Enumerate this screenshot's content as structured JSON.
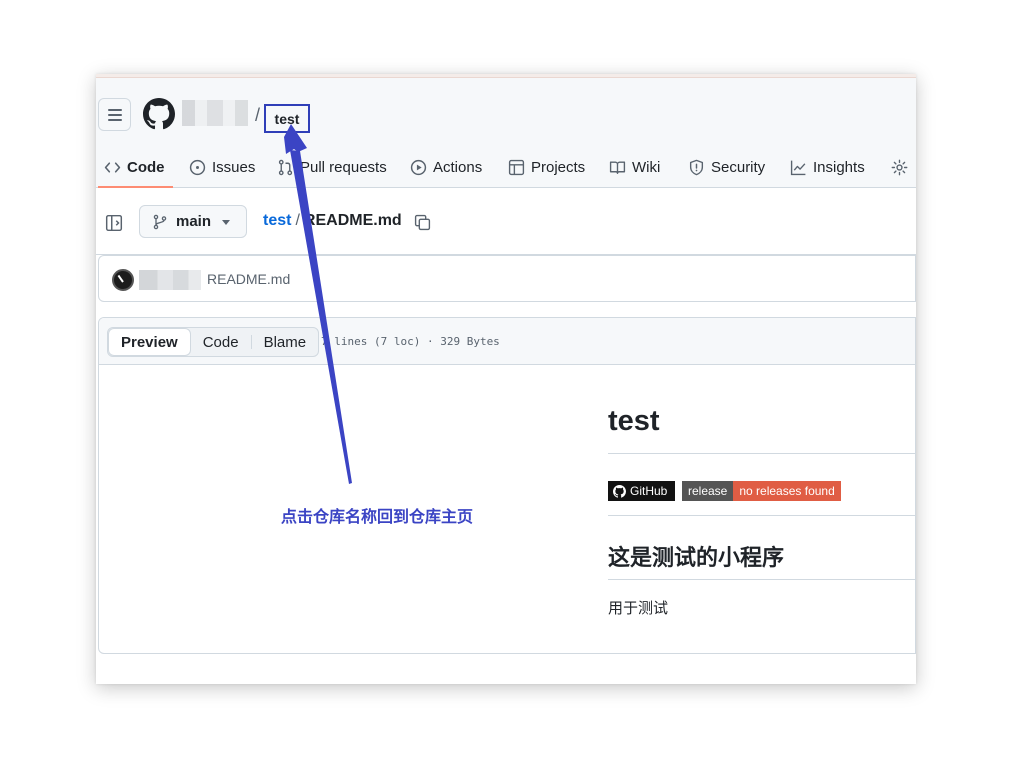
{
  "header": {
    "repo_name": "test",
    "slash": "/"
  },
  "tabs": [
    {
      "label": "Code",
      "icon": "code-icon",
      "active": true
    },
    {
      "label": "Issues",
      "icon": "issue-icon"
    },
    {
      "label": "Pull requests",
      "icon": "pull-request-icon"
    },
    {
      "label": "Actions",
      "icon": "play-icon"
    },
    {
      "label": "Projects",
      "icon": "table-icon"
    },
    {
      "label": "Wiki",
      "icon": "book-icon"
    },
    {
      "label": "Security",
      "icon": "shield-icon"
    },
    {
      "label": "Insights",
      "icon": "graph-icon"
    }
  ],
  "filebar": {
    "branch": "main",
    "path_repo": "test",
    "path_sep": "/",
    "filename": "README.md"
  },
  "commit": {
    "message": "README.md"
  },
  "file_toolbar": {
    "views": [
      "Preview",
      "Code",
      "Blame"
    ],
    "meta": "7 lines (7 loc) · 329 Bytes"
  },
  "readme": {
    "title": "test",
    "badge_github": "GitHub",
    "badge_release_label": "release",
    "badge_release_value": "no releases found",
    "heading": "这是测试的小程序",
    "paragraph": "用于测试"
  },
  "annotation": {
    "text": "点击仓库名称回到仓库主页",
    "color": "#3b44c4"
  },
  "colors": {
    "accent_link": "#0969da",
    "tab_underline": "#fd8c73",
    "badge_release_value_bg": "#e05d44"
  }
}
